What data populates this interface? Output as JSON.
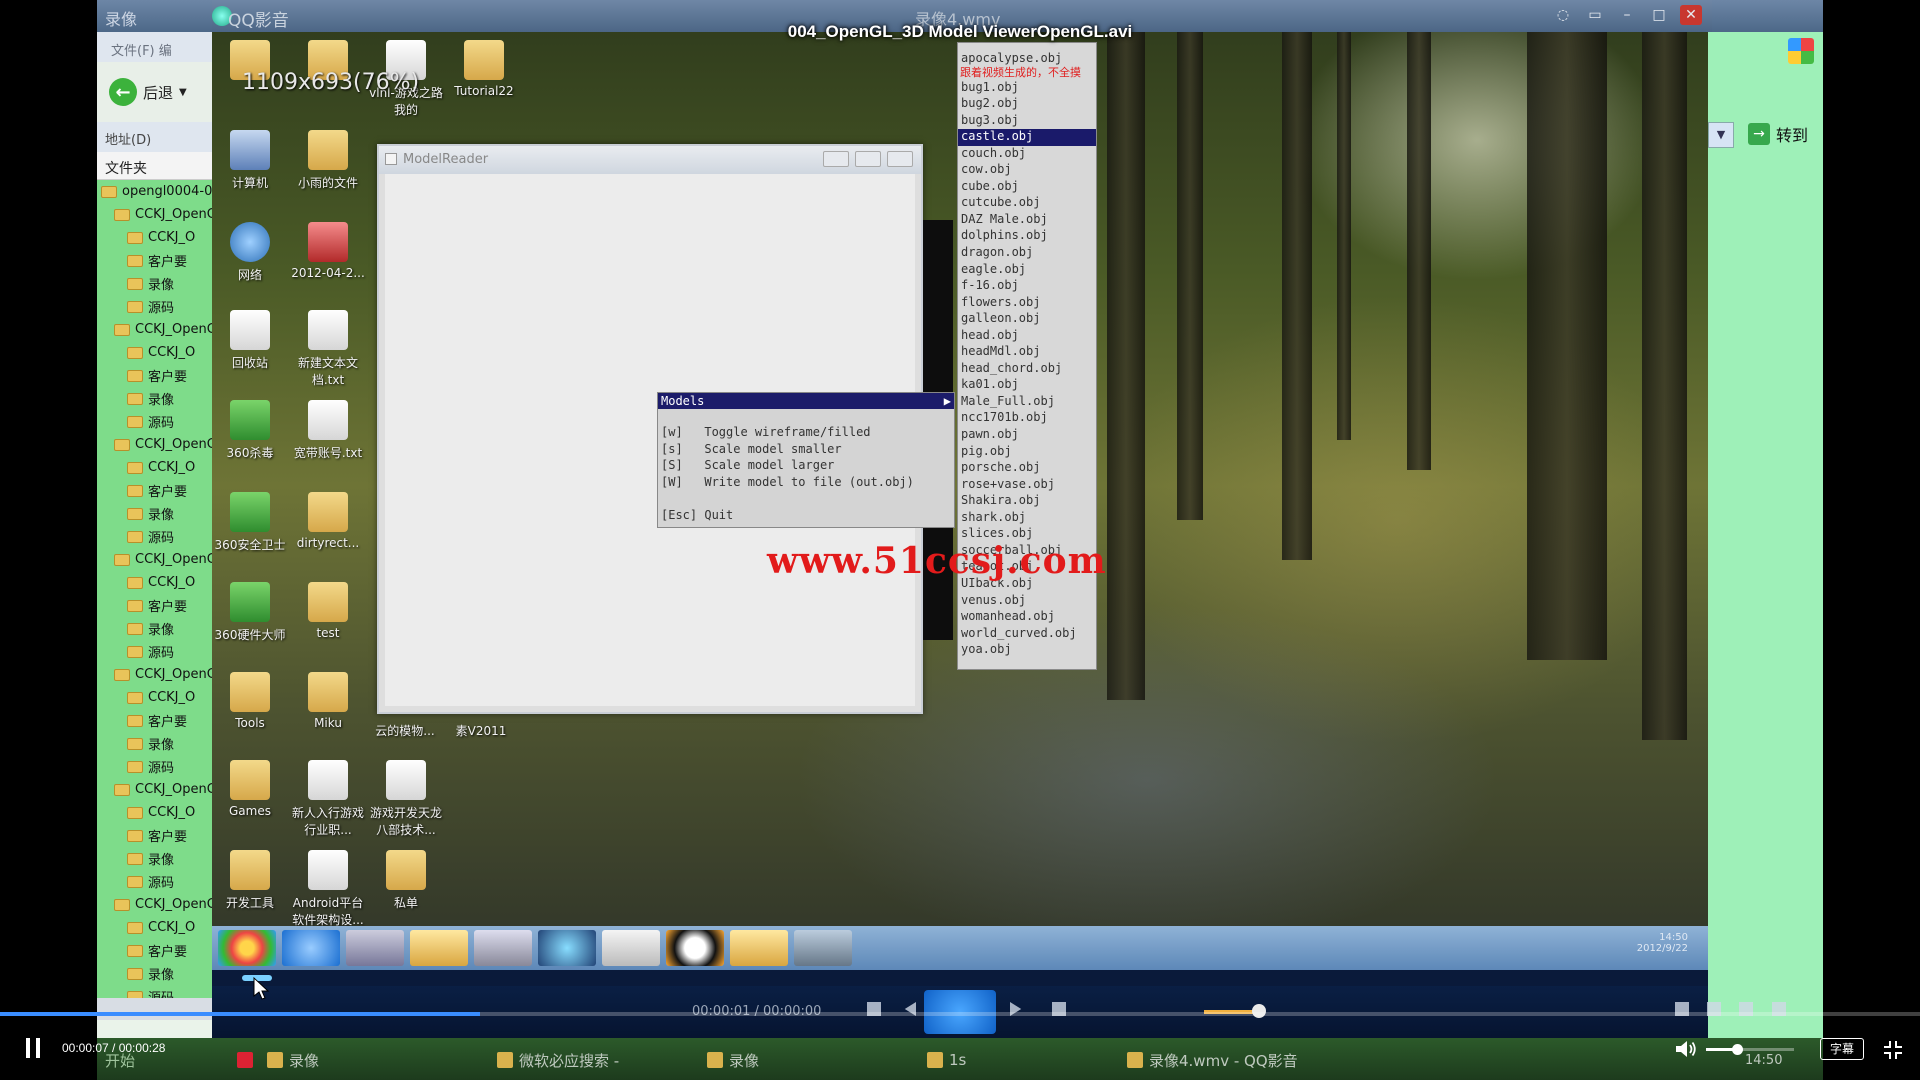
{
  "player": {
    "title": "004_OpenGL_3D Model ViewerOpenGL.avi",
    "time_display": "00:00:07 / 00:00:28",
    "progress_fraction": 0.25,
    "volume_fraction": 0.35,
    "subtitle_label": "字幕"
  },
  "recording": {
    "app_title": "QQ影音",
    "file_title": "录像4.wmv",
    "zoom_text": "1109x693(76%)",
    "explorer": {
      "title": "录像",
      "menu": "文件(F)  编",
      "back_label": "后退",
      "address_label": "地址(D)",
      "folders_label": "文件夹",
      "tree": [
        {
          "label": "opengl0004-00",
          "indent": 0
        },
        {
          "label": "CCKJ_OpenG",
          "indent": 1
        },
        {
          "label": "CCKJ_O",
          "indent": 2
        },
        {
          "label": "客户要",
          "indent": 2
        },
        {
          "label": "录像",
          "indent": 2
        },
        {
          "label": "源码",
          "indent": 2
        },
        {
          "label": "CCKJ_OpenG",
          "indent": 1
        },
        {
          "label": "CCKJ_O",
          "indent": 2
        },
        {
          "label": "客户要",
          "indent": 2
        },
        {
          "label": "录像",
          "indent": 2
        },
        {
          "label": "源码",
          "indent": 2
        },
        {
          "label": "CCKJ_OpenG",
          "indent": 1
        },
        {
          "label": "CCKJ_O",
          "indent": 2
        },
        {
          "label": "客户要",
          "indent": 2
        },
        {
          "label": "录像",
          "indent": 2
        },
        {
          "label": "源码",
          "indent": 2
        },
        {
          "label": "CCKJ_OpenG",
          "indent": 1
        },
        {
          "label": "CCKJ_O",
          "indent": 2
        },
        {
          "label": "客户要",
          "indent": 2
        },
        {
          "label": "录像",
          "indent": 2
        },
        {
          "label": "源码",
          "indent": 2
        },
        {
          "label": "CCKJ_OpenG",
          "indent": 1
        },
        {
          "label": "CCKJ_O",
          "indent": 2
        },
        {
          "label": "客户要",
          "indent": 2
        },
        {
          "label": "录像",
          "indent": 2
        },
        {
          "label": "源码",
          "indent": 2
        },
        {
          "label": "CCKJ_OpenG",
          "indent": 1
        },
        {
          "label": "CCKJ_O",
          "indent": 2
        },
        {
          "label": "客户要",
          "indent": 2
        },
        {
          "label": "录像",
          "indent": 2
        },
        {
          "label": "源码",
          "indent": 2
        },
        {
          "label": "CCKJ_OpenG",
          "indent": 1
        },
        {
          "label": "CCKJ_O",
          "indent": 2
        },
        {
          "label": "客户要",
          "indent": 2
        },
        {
          "label": "录像",
          "indent": 2
        },
        {
          "label": "源码",
          "indent": 2
        }
      ]
    },
    "goto_label": "转到",
    "desktop_icons": [
      {
        "label": "",
        "glyph": "g-folder"
      },
      {
        "label": "",
        "glyph": "g-folder"
      },
      {
        "label": "vlnl-游戏之路我的",
        "glyph": "g-doc"
      },
      {
        "label": "Tutorial22",
        "glyph": "g-folder"
      },
      {
        "label": "计算机",
        "glyph": "g-pc"
      },
      {
        "label": "小雨的文件",
        "glyph": "g-folder"
      },
      {
        "label": "网络",
        "glyph": "g-net"
      },
      {
        "label": "2012-04-2...",
        "glyph": "g-red"
      },
      {
        "label": "回收站",
        "glyph": "g-doc"
      },
      {
        "label": "新建文本文档.txt",
        "glyph": "g-doc"
      },
      {
        "label": "360杀毒",
        "glyph": "g-shield"
      },
      {
        "label": "宽带账号.txt",
        "glyph": "g-doc"
      },
      {
        "label": "360安全卫士",
        "glyph": "g-shield"
      },
      {
        "label": "dirtyrect...",
        "glyph": "g-folder"
      },
      {
        "label": "360硬件大师",
        "glyph": "g-shield"
      },
      {
        "label": "test",
        "glyph": "g-folder"
      },
      {
        "label": "Tools",
        "glyph": "g-folder"
      },
      {
        "label": "Miku",
        "glyph": "g-folder"
      },
      {
        "label": "Games",
        "glyph": "g-folder"
      },
      {
        "label": "新人入行游戏行业职...",
        "glyph": "g-doc"
      },
      {
        "label": "游戏开发天龙八部技术...",
        "glyph": "g-doc"
      },
      {
        "label": "开发工具",
        "glyph": "g-folder"
      },
      {
        "label": "Android平台软件架构设...",
        "glyph": "g-doc"
      },
      {
        "label": "私单",
        "glyph": "g-folder"
      }
    ],
    "loose_labels": [
      "云的模物...",
      "素V2011"
    ],
    "model_window_title": "ModelReader",
    "glut_menu": {
      "header": "Models",
      "rows": [
        "[w]   Toggle wireframe/filled",
        "[s]   Scale model smaller",
        "[S]   Scale model larger",
        "[W]   Write model to file (out.obj)",
        "",
        "[Esc] Quit"
      ]
    },
    "obj_files": [
      "apocalypse.obj",
      "bug1.obj",
      "bug2.obj",
      "bug3.obj",
      "castle.obj",
      "couch.obj",
      "cow.obj",
      "cube.obj",
      "cutcube.obj",
      "DAZ Male.obj",
      "dolphins.obj",
      "dragon.obj",
      "eagle.obj",
      "f-16.obj",
      "flowers.obj",
      "galleon.obj",
      "head.obj",
      "headMdl.obj",
      "head_chord.obj",
      "ka01.obj",
      "Male_Full.obj",
      "ncc1701b.obj",
      "pawn.obj",
      "pig.obj",
      "porsche.obj",
      "rose+vase.obj",
      "Shakira.obj",
      "shark.obj",
      "slices.obj",
      "soccerball.obj",
      "teapot.obj",
      "UIback.obj",
      "venus.obj",
      "womanhead.obj",
      "world_curved.obj",
      "yoa.obj"
    ],
    "obj_selected_index": 4,
    "obj_warning": "跟着视频生成的，不全摸",
    "watermark": "www.51ccsj.com",
    "rec_player_time": "00:00:01 / 00:00:00",
    "tray_time": "14:50",
    "tray_date": "2012/9/22",
    "taskbar_items": [
      "录像",
      "微软必应搜索 -",
      "录像",
      "1s",
      "录像4.wmv - QQ影音"
    ],
    "start_label": "开始",
    "taskbar_clock": "14:50"
  }
}
